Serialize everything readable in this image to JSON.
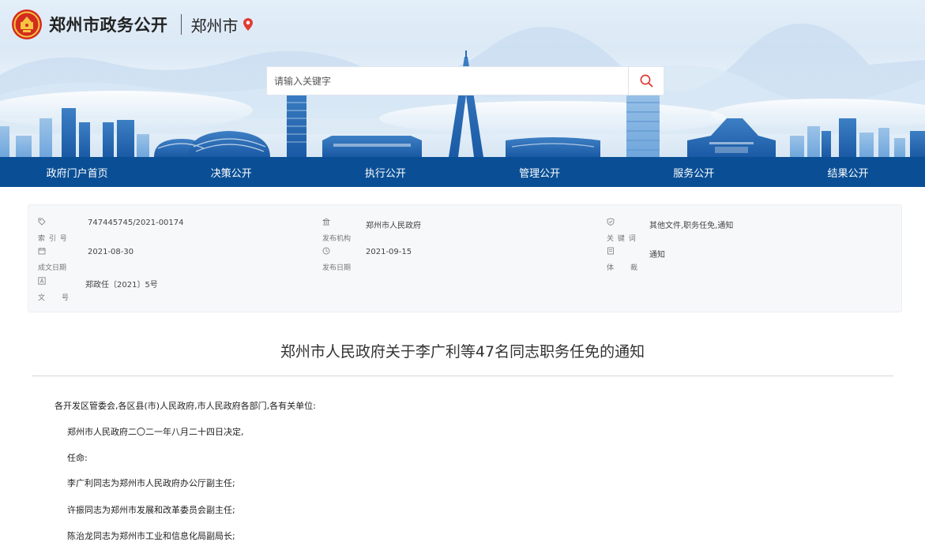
{
  "header": {
    "site_name": "郑州市政务公开",
    "city": "郑州市"
  },
  "search": {
    "placeholder": "请输入关键字"
  },
  "nav": [
    "政府门户首页",
    "决策公开",
    "执行公开",
    "管理公开",
    "服务公开",
    "结果公开"
  ],
  "meta": {
    "index_label": "索 引 号",
    "index_value": "747445745/2021-00174",
    "publisher_label": "发布机构",
    "publisher_value": "郑州市人民政府",
    "keywords_label": "关 键 词",
    "keywords_value": "其他文件,职务任免,通知",
    "written_label": "成文日期",
    "written_value": "2021-08-30",
    "published_label": "发布日期",
    "published_value": "2021-09-15",
    "genre_label": "体　　裁",
    "genre_value": "通知",
    "docno_label": "文　　号",
    "docno_value": "郑政任〔2021〕5号"
  },
  "article": {
    "title": "郑州市人民政府关于李广利等47名同志职务任免的通知",
    "salutation": "各开发区管委会,各区县(市)人民政府,市人民政府各部门,各有关单位:",
    "paragraphs": [
      "郑州市人民政府二〇二一年八月二十四日决定,",
      "任命:",
      "李广利同志为郑州市人民政府办公厅副主任;",
      "许振同志为郑州市发展和改革委员会副主任;",
      "陈治龙同志为郑州市工业和信息化局副局长;"
    ]
  },
  "colors": {
    "nav_bg": "#0a4f95",
    "accent_red": "#e03b33"
  }
}
